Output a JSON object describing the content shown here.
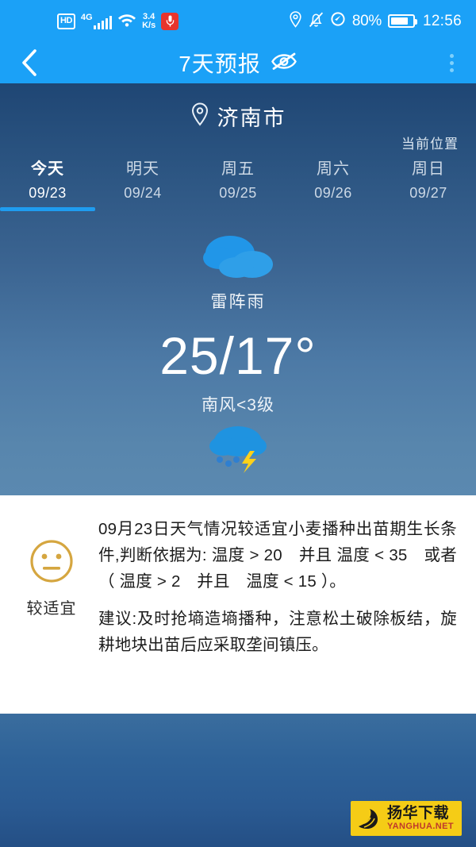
{
  "statusbar": {
    "hd_label": "HD",
    "network_label": "4G",
    "speed_value": "3.4",
    "speed_unit": "K/s",
    "battery_percent": "80%",
    "clock": "12:56",
    "icons": [
      "hd-badge",
      "signal-bars-icon",
      "wifi-icon",
      "network-speed",
      "microphone-icon",
      "location-pin-icon",
      "bell-muted-icon",
      "data-saver-icon",
      "battery-icon"
    ]
  },
  "titlebar": {
    "back_icon": "chevron-left-icon",
    "title": "7天预报",
    "hidden_icon": "eye-slash-icon",
    "menu_icon": "overflow-menu-icon"
  },
  "panel": {
    "location_icon": "location-pin-icon",
    "city": "济南市",
    "current_location_label": "当前位置",
    "tabs": [
      {
        "name": "今天",
        "date": "09/23",
        "active": true
      },
      {
        "name": "明天",
        "date": "09/24",
        "active": false
      },
      {
        "name": "周五",
        "date": "09/25",
        "active": false
      },
      {
        "name": "周六",
        "date": "09/26",
        "active": false
      },
      {
        "name": "周日",
        "date": "09/27",
        "active": false
      }
    ],
    "condition_icon": "cloudy-icon",
    "condition": "雷阵雨",
    "temperature": "25/17°",
    "wind": "南风<3级",
    "detail_icon": "thunderstorm-rain-icon"
  },
  "advisory": {
    "face_icon": "neutral-face-icon",
    "rating_label": "较适宜",
    "paragraph_1": "09月23日天气情况较适宜小麦播种出苗期生长条件,判断依据为: 温度 > 20　并且 温度 < 35　或者 （ 温度 > 2　并且　温度 < 15 ）。",
    "paragraph_2": "建议:及时抢墒造墒播种，注意松土破除板结，旋耕地块出苗后应采取垄间镇压。"
  },
  "watermark": {
    "cn_text": "扬华下载",
    "en_text": "YANGHUA.NET",
    "logo_icon": "yanghua-logo-icon"
  },
  "colors": {
    "header_blue": "#1ba1f7",
    "panel_top": "#1f4674",
    "panel_bottom": "#5b89b0",
    "accent_underline": "#1f9cf0",
    "face_gold": "#d5a640",
    "watermark_yellow": "#f5cc16",
    "mic_red": "#e8342c",
    "lightning_yellow": "#ffd11a"
  }
}
